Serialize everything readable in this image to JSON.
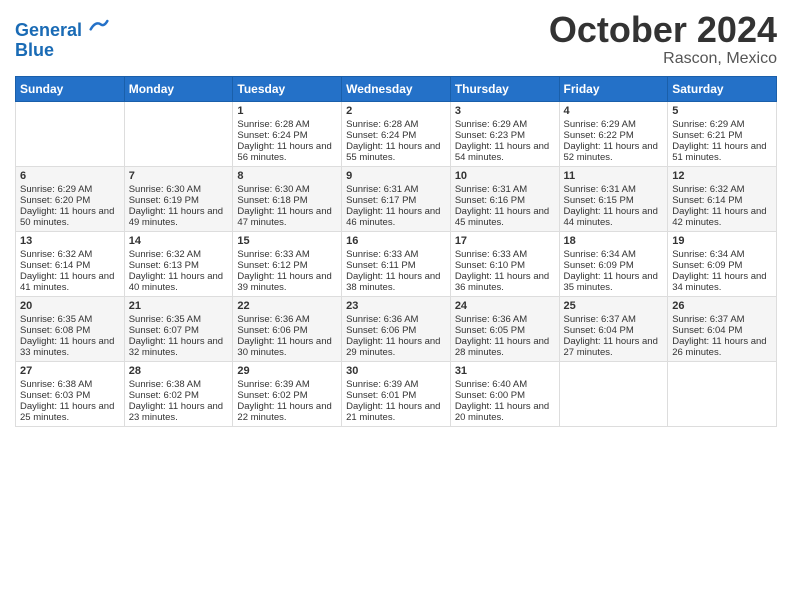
{
  "logo": {
    "line1": "General",
    "line2": "Blue"
  },
  "header": {
    "month": "October 2024",
    "location": "Rascon, Mexico"
  },
  "weekdays": [
    "Sunday",
    "Monday",
    "Tuesday",
    "Wednesday",
    "Thursday",
    "Friday",
    "Saturday"
  ],
  "weeks": [
    [
      {
        "day": null,
        "sunrise": null,
        "sunset": null,
        "daylight": null
      },
      {
        "day": null,
        "sunrise": null,
        "sunset": null,
        "daylight": null
      },
      {
        "day": "1",
        "sunrise": "Sunrise: 6:28 AM",
        "sunset": "Sunset: 6:24 PM",
        "daylight": "Daylight: 11 hours and 56 minutes."
      },
      {
        "day": "2",
        "sunrise": "Sunrise: 6:28 AM",
        "sunset": "Sunset: 6:24 PM",
        "daylight": "Daylight: 11 hours and 55 minutes."
      },
      {
        "day": "3",
        "sunrise": "Sunrise: 6:29 AM",
        "sunset": "Sunset: 6:23 PM",
        "daylight": "Daylight: 11 hours and 54 minutes."
      },
      {
        "day": "4",
        "sunrise": "Sunrise: 6:29 AM",
        "sunset": "Sunset: 6:22 PM",
        "daylight": "Daylight: 11 hours and 52 minutes."
      },
      {
        "day": "5",
        "sunrise": "Sunrise: 6:29 AM",
        "sunset": "Sunset: 6:21 PM",
        "daylight": "Daylight: 11 hours and 51 minutes."
      }
    ],
    [
      {
        "day": "6",
        "sunrise": "Sunrise: 6:29 AM",
        "sunset": "Sunset: 6:20 PM",
        "daylight": "Daylight: 11 hours and 50 minutes."
      },
      {
        "day": "7",
        "sunrise": "Sunrise: 6:30 AM",
        "sunset": "Sunset: 6:19 PM",
        "daylight": "Daylight: 11 hours and 49 minutes."
      },
      {
        "day": "8",
        "sunrise": "Sunrise: 6:30 AM",
        "sunset": "Sunset: 6:18 PM",
        "daylight": "Daylight: 11 hours and 47 minutes."
      },
      {
        "day": "9",
        "sunrise": "Sunrise: 6:31 AM",
        "sunset": "Sunset: 6:17 PM",
        "daylight": "Daylight: 11 hours and 46 minutes."
      },
      {
        "day": "10",
        "sunrise": "Sunrise: 6:31 AM",
        "sunset": "Sunset: 6:16 PM",
        "daylight": "Daylight: 11 hours and 45 minutes."
      },
      {
        "day": "11",
        "sunrise": "Sunrise: 6:31 AM",
        "sunset": "Sunset: 6:15 PM",
        "daylight": "Daylight: 11 hours and 44 minutes."
      },
      {
        "day": "12",
        "sunrise": "Sunrise: 6:32 AM",
        "sunset": "Sunset: 6:14 PM",
        "daylight": "Daylight: 11 hours and 42 minutes."
      }
    ],
    [
      {
        "day": "13",
        "sunrise": "Sunrise: 6:32 AM",
        "sunset": "Sunset: 6:14 PM",
        "daylight": "Daylight: 11 hours and 41 minutes."
      },
      {
        "day": "14",
        "sunrise": "Sunrise: 6:32 AM",
        "sunset": "Sunset: 6:13 PM",
        "daylight": "Daylight: 11 hours and 40 minutes."
      },
      {
        "day": "15",
        "sunrise": "Sunrise: 6:33 AM",
        "sunset": "Sunset: 6:12 PM",
        "daylight": "Daylight: 11 hours and 39 minutes."
      },
      {
        "day": "16",
        "sunrise": "Sunrise: 6:33 AM",
        "sunset": "Sunset: 6:11 PM",
        "daylight": "Daylight: 11 hours and 38 minutes."
      },
      {
        "day": "17",
        "sunrise": "Sunrise: 6:33 AM",
        "sunset": "Sunset: 6:10 PM",
        "daylight": "Daylight: 11 hours and 36 minutes."
      },
      {
        "day": "18",
        "sunrise": "Sunrise: 6:34 AM",
        "sunset": "Sunset: 6:09 PM",
        "daylight": "Daylight: 11 hours and 35 minutes."
      },
      {
        "day": "19",
        "sunrise": "Sunrise: 6:34 AM",
        "sunset": "Sunset: 6:09 PM",
        "daylight": "Daylight: 11 hours and 34 minutes."
      }
    ],
    [
      {
        "day": "20",
        "sunrise": "Sunrise: 6:35 AM",
        "sunset": "Sunset: 6:08 PM",
        "daylight": "Daylight: 11 hours and 33 minutes."
      },
      {
        "day": "21",
        "sunrise": "Sunrise: 6:35 AM",
        "sunset": "Sunset: 6:07 PM",
        "daylight": "Daylight: 11 hours and 32 minutes."
      },
      {
        "day": "22",
        "sunrise": "Sunrise: 6:36 AM",
        "sunset": "Sunset: 6:06 PM",
        "daylight": "Daylight: 11 hours and 30 minutes."
      },
      {
        "day": "23",
        "sunrise": "Sunrise: 6:36 AM",
        "sunset": "Sunset: 6:06 PM",
        "daylight": "Daylight: 11 hours and 29 minutes."
      },
      {
        "day": "24",
        "sunrise": "Sunrise: 6:36 AM",
        "sunset": "Sunset: 6:05 PM",
        "daylight": "Daylight: 11 hours and 28 minutes."
      },
      {
        "day": "25",
        "sunrise": "Sunrise: 6:37 AM",
        "sunset": "Sunset: 6:04 PM",
        "daylight": "Daylight: 11 hours and 27 minutes."
      },
      {
        "day": "26",
        "sunrise": "Sunrise: 6:37 AM",
        "sunset": "Sunset: 6:04 PM",
        "daylight": "Daylight: 11 hours and 26 minutes."
      }
    ],
    [
      {
        "day": "27",
        "sunrise": "Sunrise: 6:38 AM",
        "sunset": "Sunset: 6:03 PM",
        "daylight": "Daylight: 11 hours and 25 minutes."
      },
      {
        "day": "28",
        "sunrise": "Sunrise: 6:38 AM",
        "sunset": "Sunset: 6:02 PM",
        "daylight": "Daylight: 11 hours and 23 minutes."
      },
      {
        "day": "29",
        "sunrise": "Sunrise: 6:39 AM",
        "sunset": "Sunset: 6:02 PM",
        "daylight": "Daylight: 11 hours and 22 minutes."
      },
      {
        "day": "30",
        "sunrise": "Sunrise: 6:39 AM",
        "sunset": "Sunset: 6:01 PM",
        "daylight": "Daylight: 11 hours and 21 minutes."
      },
      {
        "day": "31",
        "sunrise": "Sunrise: 6:40 AM",
        "sunset": "Sunset: 6:00 PM",
        "daylight": "Daylight: 11 hours and 20 minutes."
      },
      {
        "day": null,
        "sunrise": null,
        "sunset": null,
        "daylight": null
      },
      {
        "day": null,
        "sunrise": null,
        "sunset": null,
        "daylight": null
      }
    ]
  ]
}
